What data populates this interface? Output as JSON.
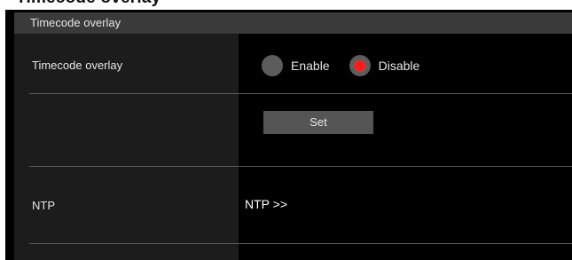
{
  "page_heading_fragment": "Timecode overlay",
  "section": {
    "title": "Timecode overlay"
  },
  "rows": {
    "timecode_overlay": {
      "label": "Timecode overlay",
      "options": [
        {
          "label": "Enable",
          "selected": false
        },
        {
          "label": "Disable",
          "selected": true
        }
      ]
    },
    "ntp": {
      "label": "NTP",
      "link": "NTP >>"
    }
  },
  "buttons": {
    "set": "Set"
  },
  "colors": {
    "panel_bg": "#000000",
    "label_column_bg": "#1c1c1c",
    "header_bg": "#3a3a3a",
    "radio_selected": "#ff1a1a",
    "button_bg": "#555555"
  }
}
